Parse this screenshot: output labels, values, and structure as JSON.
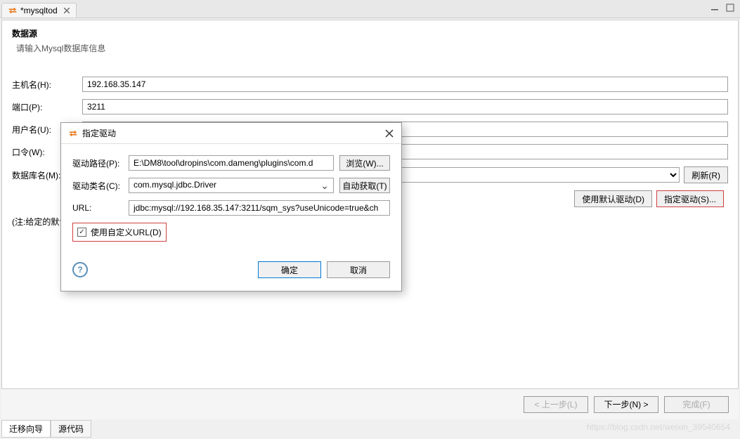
{
  "tab": {
    "title": "*mysqltod",
    "icon": "swap-icon"
  },
  "header": {
    "title": "数据源",
    "subtitle": "请输入Mysql数据库信息"
  },
  "form": {
    "host_label": "主机名(H):",
    "host_value": "192.168.35.147",
    "port_label": "端口(P):",
    "port_value": "3211",
    "user_label": "用户名(U):",
    "user_value": "",
    "pwd_label": "口令(W):",
    "pwd_value": "",
    "db_label": "数据库名(M):",
    "db_value": "",
    "refresh_btn": "刷新(R)",
    "default_driver_btn": "使用默认驱动(D)",
    "spec_driver_btn": "指定驱动(S)...",
    "note": "(注:给定的默认"
  },
  "dialog": {
    "title": "指定驱动",
    "path_label": "驱动路径(P):",
    "path_value": "E:\\DM8\\tool\\dropins\\com.dameng\\plugins\\com.d",
    "browse_btn": "浏览(W)...",
    "class_label": "驱动类名(C):",
    "class_value": "com.mysql.jdbc.Driver",
    "autoget_btn": "自动获取(T)",
    "url_label": "URL:",
    "url_value": "jdbc:mysql://192.168.35.147:3211/sqm_sys?useUnicode=true&ch",
    "custom_url_label": "使用自定义URL(D)",
    "ok_btn": "确定",
    "cancel_btn": "取消"
  },
  "wizard": {
    "prev": "< 上一步(L)",
    "next": "下一步(N) >",
    "finish": "完成(F)"
  },
  "bottom_tabs": {
    "t1": "迁移向导",
    "t2": "源代码"
  },
  "watermark": "https://blog.csdn.net/weixin_39540654"
}
